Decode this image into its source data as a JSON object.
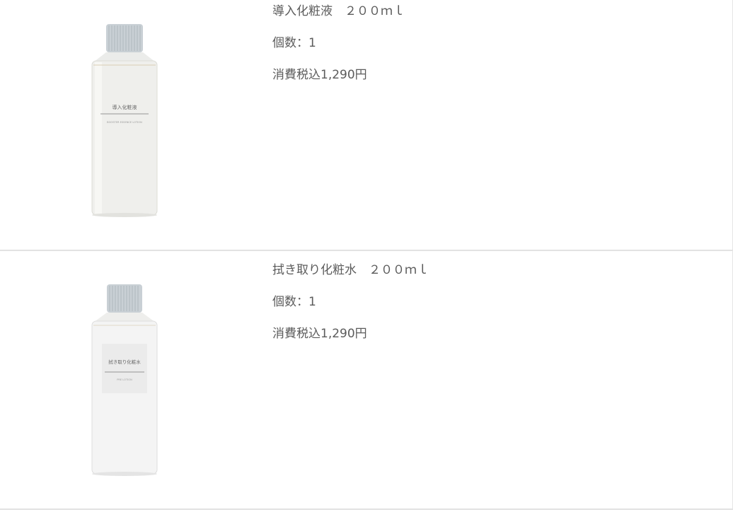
{
  "cart_items": [
    {
      "name": "導入化粧液　２００ｍｌ",
      "quantity": "個数：1",
      "price": "消費税込1,290円",
      "bottle_label_jp": "導入化粧液",
      "bottle_label_en": "BOOSTER ESSENCE LOTION",
      "image_icon": "booster-lotion-bottle-icon"
    },
    {
      "name": "拭き取り化粧水　２００ｍｌ",
      "quantity": "個数：1",
      "price": "消費税込1,290円",
      "bottle_label_jp": "拭き取り化粧水",
      "bottle_label_en": "PRE LOTION",
      "image_icon": "pre-lotion-bottle-icon"
    }
  ],
  "colors": {
    "text": "#5b5b5b",
    "divider": "#e2e2e2",
    "cap": "#b9c2c8",
    "background": "#ffffff"
  }
}
